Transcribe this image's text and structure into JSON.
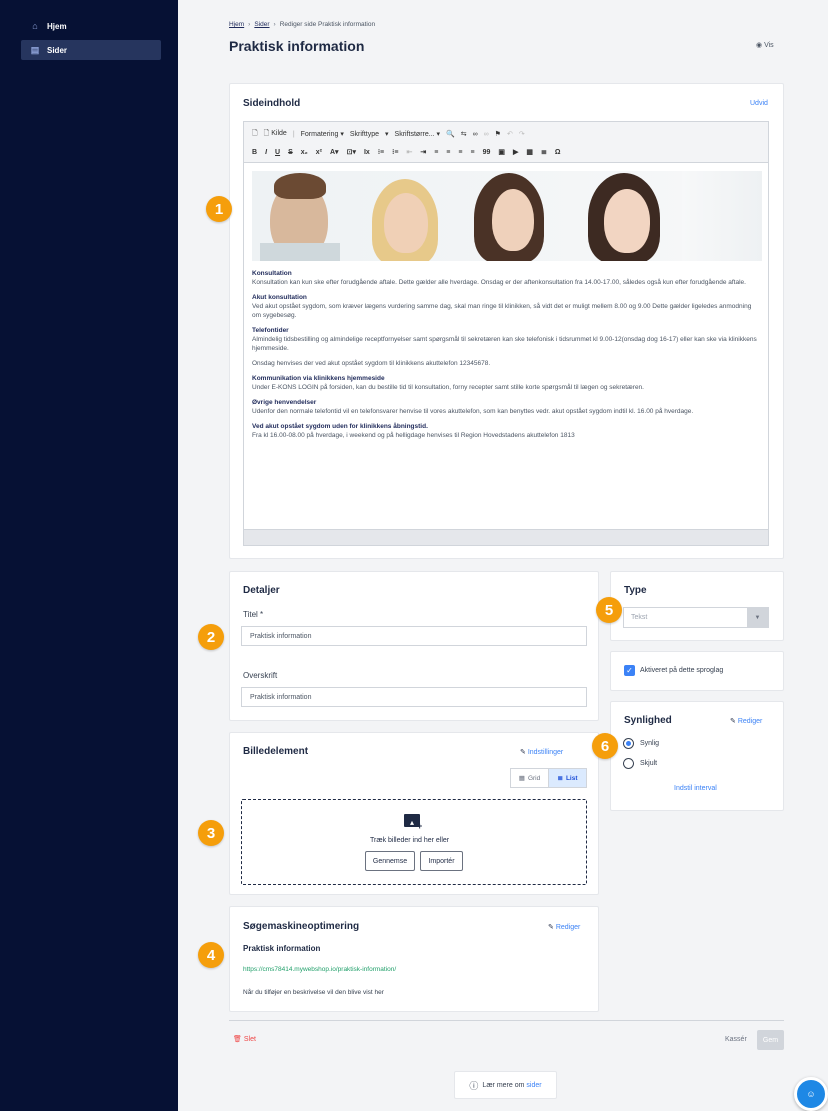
{
  "sidebar": {
    "items": [
      {
        "label": "Hjem",
        "icon": "home-icon"
      },
      {
        "label": "Sider",
        "icon": "pages-icon"
      }
    ]
  },
  "breadcrumb": {
    "home": "Hjem",
    "pages": "Sider",
    "current": "Rediger side Praktisk information"
  },
  "page": {
    "title": "Praktisk information",
    "view_label": "Vis"
  },
  "content_card": {
    "title": "Sideindhold",
    "expand": "Udvid"
  },
  "toolbar": {
    "row1": [
      "Kilde",
      "Formatering ▾",
      "Skrifttype",
      "▾",
      "Skriftstørre... ▾"
    ],
    "row2": [
      "B",
      "I",
      "U",
      "S",
      "x₂",
      "x²",
      "A▾",
      "⊡▾",
      "Ix",
      "⁝≡",
      "⁝≡",
      "⇤",
      "⇥",
      "≡",
      "≡",
      "≡",
      "≡",
      "99",
      "▣",
      "▶",
      "▦",
      "≣",
      "Ω"
    ]
  },
  "editor": {
    "sections": [
      {
        "heading": "Konsultation",
        "body": "Konsultation kan kun ske efter forudgående aftale. Dette gælder alle hverdage. Onsdag er der aftenkonsultation fra 14.00-17.00, således også kun efter forudgående aftale."
      },
      {
        "heading": "Akut konsultation",
        "body": "Ved akut opstået sygdom, som kræver lægens vurdering samme dag, skal man ringe til klinikken, så vidt det er muligt mellem 8.00 og 9.00 Dette gælder ligeledes anmodning om sygebesøg."
      },
      {
        "heading": "Telefontider",
        "body": "Almindelig tidsbestilling og almindelige receptfornyelser samt spørgsmål til sekretæren kan ske telefonisk i tidsrummet kl 9.00-12(onsdag dog 16-17) eller kan ske via klinikkens hjemmeside."
      },
      {
        "heading": "",
        "body": "Onsdag henvises der ved akut opstået sygdom til klinikkens akuttelefon 12345678."
      },
      {
        "heading": "Kommunikation via klinikkens hjemmeside",
        "body": "Under E-KONS LOGIN på forsiden, kan du bestille tid til konsultation, forny recepter samt stille korte spørgsmål til lægen og sekretæren."
      },
      {
        "heading": "Øvrige henvendelser",
        "body": "Udenfor den normale telefontid vil en telefonsvarer henvise til vores akuttelefon, som kan benyttes vedr. akut opstået sygdom indtil kl. 16.00 på hverdage."
      },
      {
        "heading": "Ved akut opstået sygdom uden for klinikkens åbningstid.",
        "body": "Fra kl 16.00-08.00 på hverdage, i weekend og på helligdage henvises til Region Hovedstadens akuttelefon 1813"
      }
    ]
  },
  "details": {
    "title": "Detaljer",
    "title_label": "Titel *",
    "title_value": "Praktisk information",
    "heading_label": "Overskrift",
    "heading_value": "Praktisk information"
  },
  "type": {
    "title": "Type",
    "value": "Tekst"
  },
  "language": {
    "label": "Aktiveret på dette sproglag",
    "checked": true
  },
  "visibility": {
    "title": "Synlighed",
    "edit": "Rediger",
    "visible": "Synlig",
    "hidden": "Skjult",
    "interval": "Indstil interval",
    "selected": "Synlig"
  },
  "image": {
    "title": "Billedelement",
    "settings": "Indstillinger",
    "grid": "Grid",
    "list": "List",
    "drop_text": "Træk billeder ind her eller",
    "browse": "Gennemse",
    "import": "Importér"
  },
  "seo": {
    "title": "Søgemaskineoptimering",
    "edit": "Rediger",
    "page_title": "Praktisk information",
    "url": "https://cms78414.mywebshop.io/praktisk-information/",
    "hint": "Når du tilføjer en beskrivelse vil den blive vist her"
  },
  "footer": {
    "delete": "Slet",
    "discard": "Kassér",
    "save": "Gem",
    "learn_prefix": "Lær mere om ",
    "learn_link": "sider"
  },
  "badges": [
    "1",
    "2",
    "3",
    "4",
    "5",
    "6"
  ],
  "colors": {
    "sidebar": "#061134",
    "accent": "#3b82f6",
    "badge": "#f59e0b",
    "link_green": "#22a06b"
  }
}
